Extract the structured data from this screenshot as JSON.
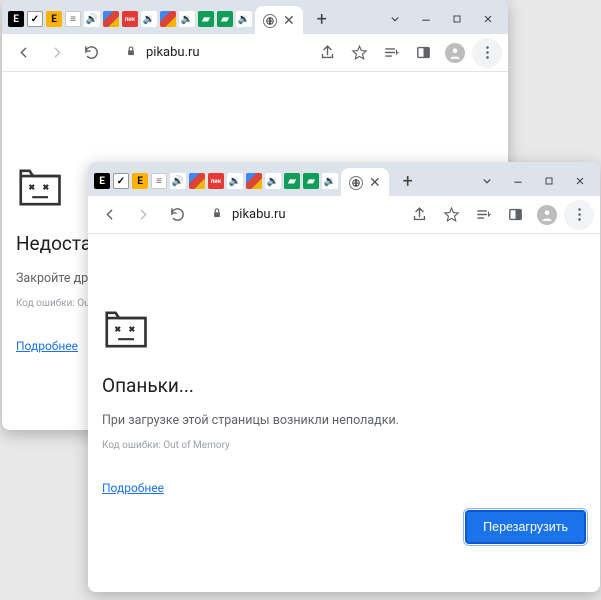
{
  "windows": {
    "a": {
      "url": "pikabu.ru",
      "error_title": "Недостато",
      "error_message": "Закройте другие в",
      "error_code": "Код ошибки: Out of Mem",
      "details_link": "Подробнее"
    },
    "b": {
      "url": "pikabu.ru",
      "error_title": "Опаньки...",
      "error_message": "При загрузке этой страницы возникли неполадки.",
      "error_code": "Код ошибки: Out of Memory",
      "details_link": "Подробнее",
      "reload_button": "Перезагрузить"
    }
  },
  "ext_icons": [
    {
      "bg": "#000",
      "txt": "E"
    },
    {
      "bg": "#fff",
      "txt": "✓",
      "fg": "#000",
      "border": "1px solid #999"
    },
    {
      "bg": "#ffb300",
      "txt": "E",
      "fg": "#000"
    },
    {
      "bg": "#fff",
      "txt": "≡",
      "fg": "#666",
      "border": "1px solid #ccc"
    },
    {
      "bg": "#fff",
      "txt": "🔊",
      "fg": "#555"
    },
    {
      "bg": "#3cba54",
      "txt": "",
      "grad": "linear-gradient(135deg,#4285F4 33%,#DB4437 33% 66%,#F4B400 66%)"
    },
    {
      "bg": "#e53935",
      "txt": "пик",
      "fg": "#fff",
      "fs": "6px"
    },
    {
      "bg": "#fff",
      "txt": "🔉",
      "fg": "#555"
    },
    {
      "bg": "#fff",
      "txt": "",
      "grad": "linear-gradient(135deg,#4285F4 33%,#DB4437 33% 66%,#F4B400 66%)"
    },
    {
      "bg": "#fff",
      "txt": "🔉",
      "fg": "#555"
    },
    {
      "bg": "#0f9d58",
      "txt": "▰",
      "fg": "#fff"
    },
    {
      "bg": "#0f9d58",
      "txt": "▰",
      "fg": "#fff"
    },
    {
      "bg": "#fff",
      "txt": "🔉",
      "fg": "#555"
    }
  ]
}
